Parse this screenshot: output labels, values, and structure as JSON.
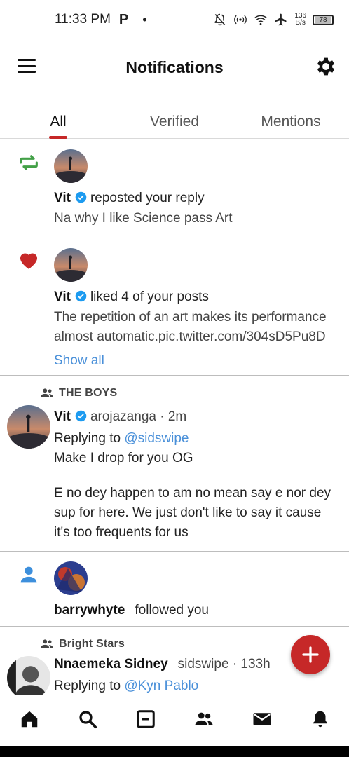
{
  "status_bar": {
    "time": "11:33 PM",
    "carrier_icon": "P",
    "dot": "•",
    "net_speed_value": "136",
    "net_speed_unit": "B/s",
    "battery": "78"
  },
  "header": {
    "title": "Notifications",
    "menu_icon": "hamburger-menu-icon",
    "settings_icon": "gear-icon"
  },
  "tabs": [
    {
      "label": "All",
      "active": true
    },
    {
      "label": "Verified",
      "active": false
    },
    {
      "label": "Mentions",
      "active": false
    }
  ],
  "notifications": [
    {
      "type_icon": "repost-icon",
      "user": "Vit",
      "verified": true,
      "action": "reposted your reply",
      "text": "Na why I like Science pass Art"
    },
    {
      "type_icon": "heart-icon",
      "user": "Vit",
      "verified": true,
      "action": "liked 4 of your posts",
      "text_line1": "The repetition of an art makes its performance",
      "text_line2": "almost automatic.pic.twitter.com/304sD5Pu8D",
      "show_all": "Show all"
    },
    {
      "group": "THE BOYS",
      "user": "Vit",
      "verified": true,
      "handle": "arojazanga",
      "separator": "·",
      "time": "2m",
      "replying_prefix": "Replying to",
      "replying_to": "@sidswipe",
      "body_line1": "Make I drop for you OG",
      "body_line2": "E no dey happen to am no mean say e nor dey",
      "body_line3": "sup for here. We just don't like to say it cause",
      "body_line4": "it's too frequents for us"
    },
    {
      "type_icon": "person-icon",
      "user": "barrywhyte",
      "action": "followed you"
    },
    {
      "group": "Bright Stars",
      "user": "Nnaemeka Sidney",
      "handle": "sidswipe",
      "separator": "·",
      "time": "133h",
      "replying_prefix": "Replying to",
      "replying_to": "@Kyn Pablo"
    }
  ],
  "fab": {
    "icon": "plus-icon"
  },
  "bottom_nav": [
    "home-icon",
    "search-icon",
    "feed-icon",
    "groups-icon",
    "mail-icon",
    "bell-icon"
  ],
  "colors": {
    "accent_red": "#c62828",
    "repost_green": "#43a047",
    "link_blue": "#4a90d9",
    "verified_blue": "#1d9bf0",
    "follow_blue": "#3d8fdc"
  }
}
